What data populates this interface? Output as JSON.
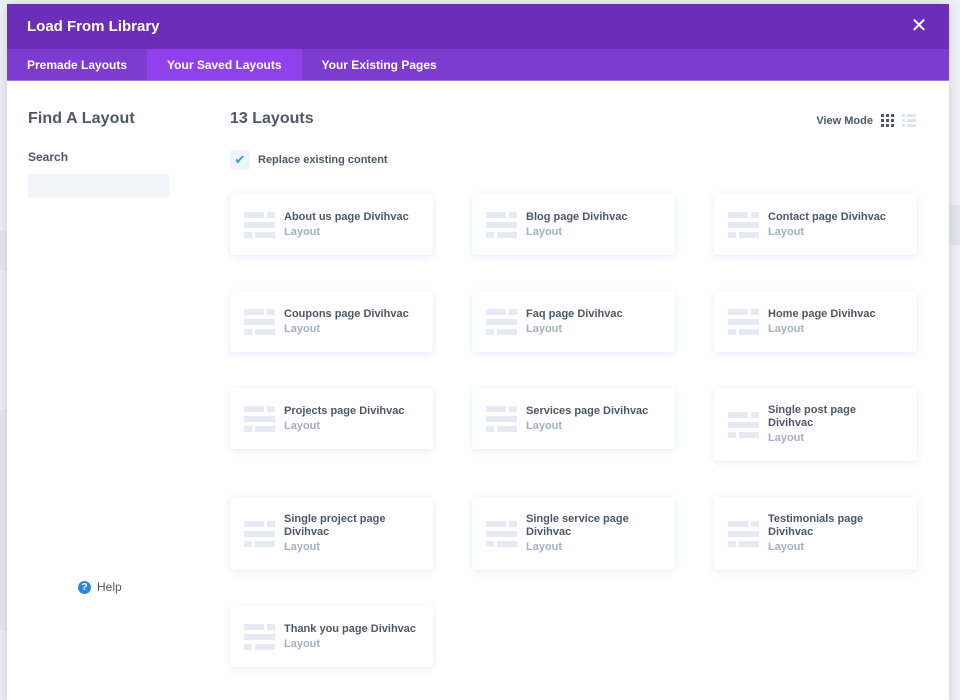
{
  "modal": {
    "title": "Load From Library",
    "close_icon": "close-icon"
  },
  "tabs": [
    {
      "label": "Premade Layouts",
      "active": false
    },
    {
      "label": "Your Saved Layouts",
      "active": true
    },
    {
      "label": "Your Existing Pages",
      "active": false
    }
  ],
  "sidebar": {
    "title": "Find A Layout",
    "search_label": "Search",
    "search_value": "",
    "search_placeholder": "",
    "help_label": "Help"
  },
  "main": {
    "count_title": "13 Layouts",
    "view_mode_label": "View Mode",
    "view_mode_selected": "grid",
    "replace_label": "Replace existing content",
    "replace_checked": true
  },
  "layouts": [
    {
      "title": "About us page Divihvac",
      "type": "Layout"
    },
    {
      "title": "Blog page Divihvac",
      "type": "Layout"
    },
    {
      "title": "Contact page Divihvac",
      "type": "Layout"
    },
    {
      "title": "Coupons page Divihvac",
      "type": "Layout"
    },
    {
      "title": "Faq page Divihvac",
      "type": "Layout"
    },
    {
      "title": "Home page Divihvac",
      "type": "Layout"
    },
    {
      "title": "Projects page Divihvac",
      "type": "Layout"
    },
    {
      "title": "Services page Divihvac",
      "type": "Layout"
    },
    {
      "title": "Single post page Divihvac",
      "type": "Layout"
    },
    {
      "title": "Single project page Divihvac",
      "type": "Layout"
    },
    {
      "title": "Single service page Divihvac",
      "type": "Layout"
    },
    {
      "title": "Testimonials page Divihvac",
      "type": "Layout"
    },
    {
      "title": "Thank you page Divihvac",
      "type": "Layout"
    }
  ],
  "colors": {
    "header": "#6c2eb9",
    "tabs": "#7d3bcf",
    "tab_active": "#8f42ec",
    "help_icon": "#2b87da",
    "checkmark": "#2ea3b9"
  }
}
